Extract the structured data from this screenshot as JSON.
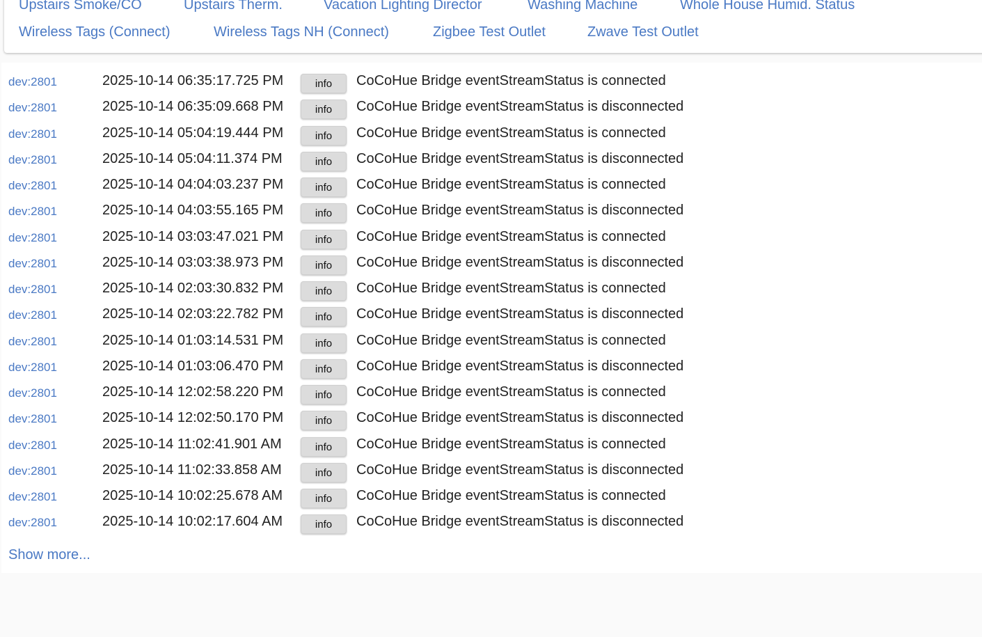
{
  "devices_row1": [
    "Upstairs Smoke/CO",
    "Upstairs Therm.",
    "Vacation Lighting Director",
    "Washing Machine",
    "Whole House Humid. Status"
  ],
  "devices_row2": [
    "Wireless Tags (Connect)",
    "Wireless Tags NH (Connect)",
    "Zigbee Test Outlet",
    "Zwave Test Outlet"
  ],
  "logs": [
    {
      "dev": "dev:2801",
      "time": "2025-10-14 06:35:17.725 PM",
      "level": "info",
      "msg": "CoCoHue Bridge eventStreamStatus is connected"
    },
    {
      "dev": "dev:2801",
      "time": "2025-10-14 06:35:09.668 PM",
      "level": "info",
      "msg": "CoCoHue Bridge eventStreamStatus is disconnected"
    },
    {
      "dev": "dev:2801",
      "time": "2025-10-14 05:04:19.444 PM",
      "level": "info",
      "msg": "CoCoHue Bridge eventStreamStatus is connected"
    },
    {
      "dev": "dev:2801",
      "time": "2025-10-14 05:04:11.374 PM",
      "level": "info",
      "msg": "CoCoHue Bridge eventStreamStatus is disconnected"
    },
    {
      "dev": "dev:2801",
      "time": "2025-10-14 04:04:03.237 PM",
      "level": "info",
      "msg": "CoCoHue Bridge eventStreamStatus is connected"
    },
    {
      "dev": "dev:2801",
      "time": "2025-10-14 04:03:55.165 PM",
      "level": "info",
      "msg": "CoCoHue Bridge eventStreamStatus is disconnected"
    },
    {
      "dev": "dev:2801",
      "time": "2025-10-14 03:03:47.021 PM",
      "level": "info",
      "msg": "CoCoHue Bridge eventStreamStatus is connected"
    },
    {
      "dev": "dev:2801",
      "time": "2025-10-14 03:03:38.973 PM",
      "level": "info",
      "msg": "CoCoHue Bridge eventStreamStatus is disconnected"
    },
    {
      "dev": "dev:2801",
      "time": "2025-10-14 02:03:30.832 PM",
      "level": "info",
      "msg": "CoCoHue Bridge eventStreamStatus is connected"
    },
    {
      "dev": "dev:2801",
      "time": "2025-10-14 02:03:22.782 PM",
      "level": "info",
      "msg": "CoCoHue Bridge eventStreamStatus is disconnected"
    },
    {
      "dev": "dev:2801",
      "time": "2025-10-14 01:03:14.531 PM",
      "level": "info",
      "msg": "CoCoHue Bridge eventStreamStatus is connected"
    },
    {
      "dev": "dev:2801",
      "time": "2025-10-14 01:03:06.470 PM",
      "level": "info",
      "msg": "CoCoHue Bridge eventStreamStatus is disconnected"
    },
    {
      "dev": "dev:2801",
      "time": "2025-10-14 12:02:58.220 PM",
      "level": "info",
      "msg": "CoCoHue Bridge eventStreamStatus is connected"
    },
    {
      "dev": "dev:2801",
      "time": "2025-10-14 12:02:50.170 PM",
      "level": "info",
      "msg": "CoCoHue Bridge eventStreamStatus is disconnected"
    },
    {
      "dev": "dev:2801",
      "time": "2025-10-14 11:02:41.901 AM",
      "level": "info",
      "msg": "CoCoHue Bridge eventStreamStatus is connected"
    },
    {
      "dev": "dev:2801",
      "time": "2025-10-14 11:02:33.858 AM",
      "level": "info",
      "msg": "CoCoHue Bridge eventStreamStatus is disconnected"
    },
    {
      "dev": "dev:2801",
      "time": "2025-10-14 10:02:25.678 AM",
      "level": "info",
      "msg": "CoCoHue Bridge eventStreamStatus is connected"
    },
    {
      "dev": "dev:2801",
      "time": "2025-10-14 10:02:17.604 AM",
      "level": "info",
      "msg": "CoCoHue Bridge eventStreamStatus is disconnected"
    }
  ],
  "show_more_label": "Show more...",
  "colors": {
    "link": "#4a79c4",
    "text": "#222222",
    "badge_bg": "#dcdcdc"
  }
}
